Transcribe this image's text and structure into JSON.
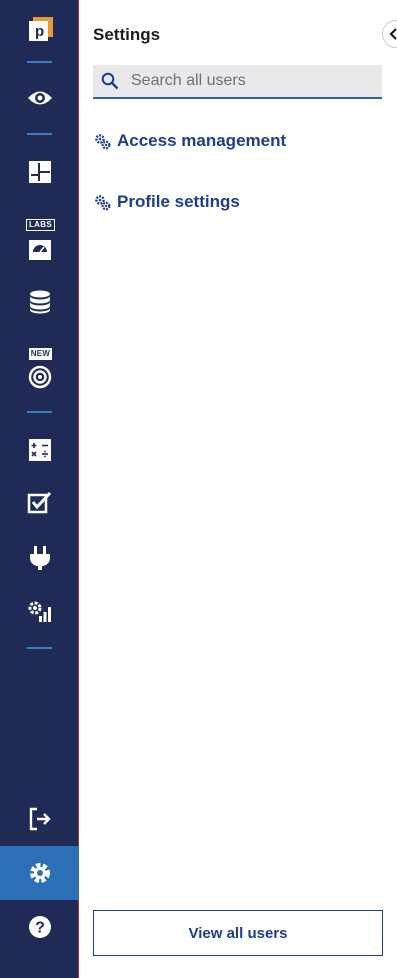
{
  "panel": {
    "title": "Settings",
    "search_placeholder": "Search all users",
    "links": [
      {
        "label": "Access management",
        "icon": "gears-icon"
      },
      {
        "label": "Profile settings",
        "icon": "gears-icon"
      }
    ],
    "view_all_label": "View all users"
  },
  "rail": {
    "badges": {
      "labs": "LABS",
      "new": "NEW"
    },
    "items": [
      {
        "name": "logo",
        "icon": "logo-icon"
      },
      {
        "name": "monitoring",
        "icon": "eye-icon"
      },
      {
        "name": "dashboard",
        "icon": "dashboard-layout-icon"
      },
      {
        "name": "labs-gauge",
        "icon": "gauge-icon"
      },
      {
        "name": "database",
        "icon": "database-icon"
      },
      {
        "name": "target",
        "icon": "target-icon"
      },
      {
        "name": "calculator",
        "icon": "calculator-icon"
      },
      {
        "name": "checklist",
        "icon": "checkbox-icon"
      },
      {
        "name": "integrations",
        "icon": "plug-icon"
      },
      {
        "name": "performance",
        "icon": "gear-chart-icon"
      },
      {
        "name": "logout",
        "icon": "logout-icon"
      },
      {
        "name": "settings",
        "icon": "gear-icon",
        "active": true
      },
      {
        "name": "help",
        "icon": "help-icon"
      }
    ]
  },
  "colors": {
    "rail_bg": "#1f2a57",
    "rail_active": "#2d6fb6",
    "separator": "#3b80c6",
    "link": "#1d3d8f",
    "search_bg": "#e9e9ec"
  }
}
